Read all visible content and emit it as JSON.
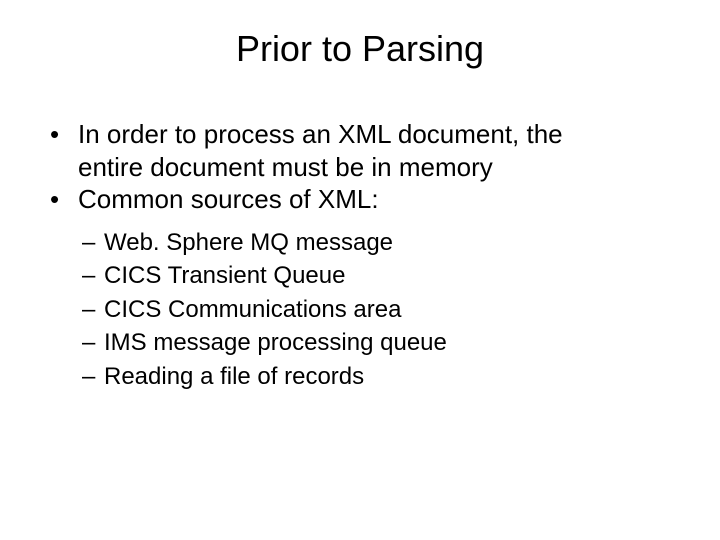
{
  "title": "Prior to Parsing",
  "bullets": {
    "b1_line1": "In order to process an XML document, the",
    "b1_line2": "entire document must be in memory",
    "b2": "Common sources of XML:"
  },
  "subs": {
    "s1": "Web. Sphere MQ message",
    "s2": "CICS Transient Queue",
    "s3": "CICS Communications area",
    "s4": "IMS message processing queue",
    "s5": "Reading a file of records"
  },
  "marks": {
    "bullet": "•",
    "dash": "–"
  }
}
